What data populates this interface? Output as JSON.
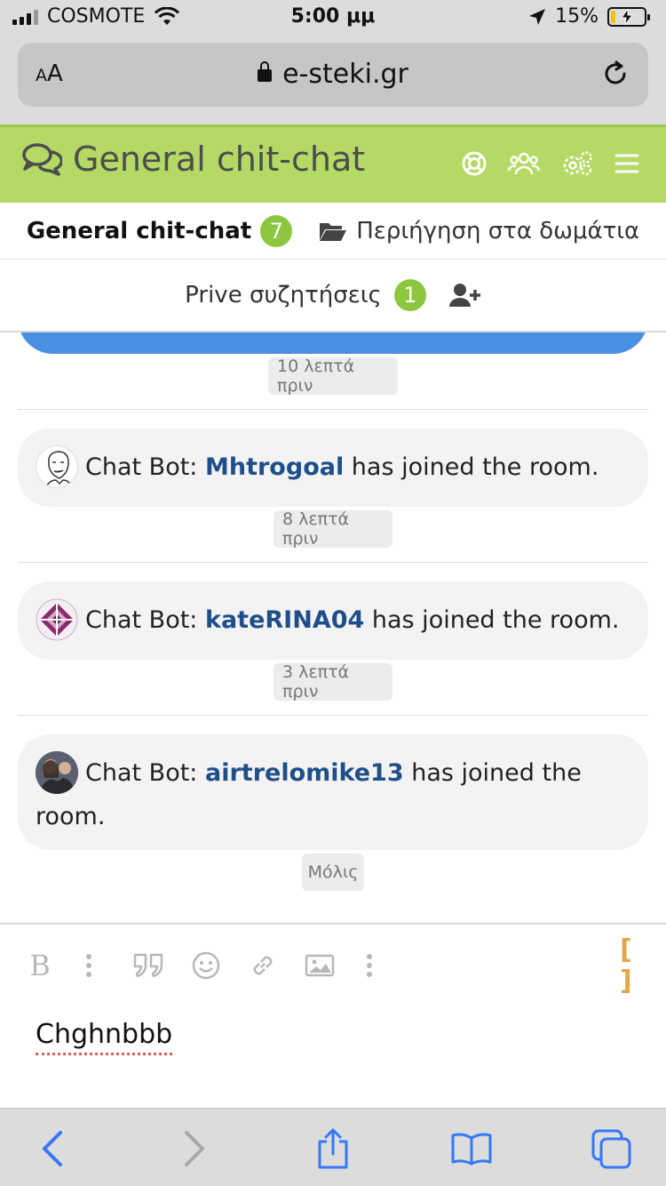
{
  "status_bar": {
    "carrier": "COSMOTE",
    "time": "5:00 μμ",
    "battery_percent": "15%",
    "battery_level": 0.15
  },
  "browser": {
    "text_size_label_small": "A",
    "text_size_label_large": "A",
    "url": "e-steki.gr"
  },
  "forum": {
    "title": "General chit-chat",
    "icons": [
      "support-icon",
      "users-icon",
      "settings-icon",
      "menu-icon"
    ]
  },
  "tabs": {
    "general_label": "General chit-chat",
    "general_count": "7",
    "rooms_label": "Περιήγηση στα δωμάτια",
    "private_label": "Prive συζητήσεις",
    "private_count": "1"
  },
  "messages": [
    {
      "time": "10 λεπτά πριν"
    },
    {
      "sender": "Chat Bot:",
      "user": "Mhtrogoal",
      "text": " has joined the room.",
      "time": "8 λεπτά πριν"
    },
    {
      "sender": "Chat Bot:",
      "user": "kateRINA04",
      "text": " has joined the room.",
      "time": "3 λεπτά πριν"
    },
    {
      "sender": "Chat Bot:",
      "user": "airtrelomike13",
      "text": " has joined the room.",
      "time": "Μόλις"
    }
  ],
  "editor": {
    "bold_label": "B",
    "bracket_label": "[ ]",
    "draft_text": "Chghnbbb"
  },
  "colors": {
    "header_green": "#b4d964",
    "badge_green": "#8dc63f",
    "username_blue": "#1f4f8a",
    "bubble_blue": "#4a90e2",
    "ios_blue": "#3478f6",
    "bracket_orange": "#e0a84a"
  }
}
